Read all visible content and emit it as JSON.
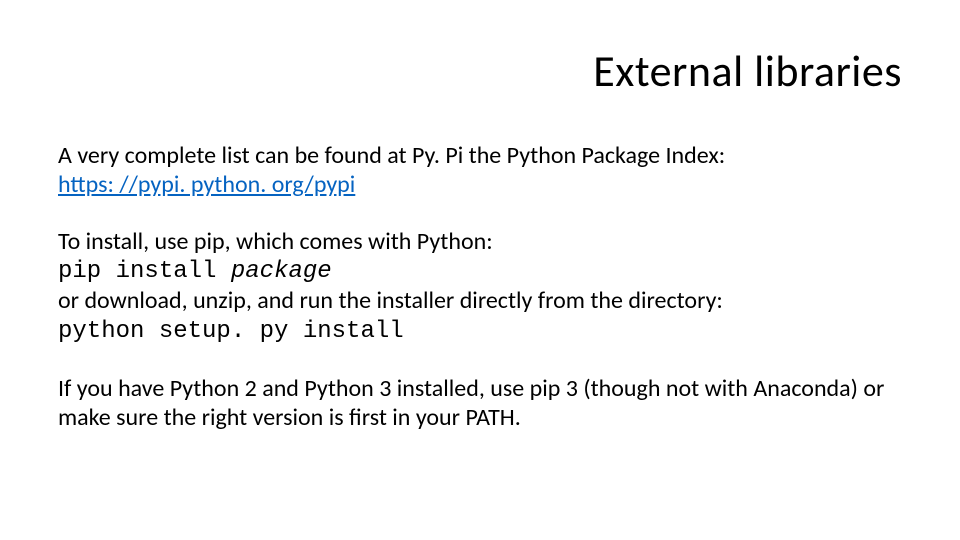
{
  "title": "External libraries",
  "para1": {
    "intro": "A very complete list can be found at Py. Pi the Python Package Index:",
    "link": "https: //pypi. python. org/pypi"
  },
  "para2": {
    "line1": "To install, use pip, which comes with Python:",
    "cmd1_prefix": "pip install ",
    "cmd1_pkg": "package",
    "line2": "or download, unzip, and run the installer directly from the directory:",
    "cmd2": "python setup. py install"
  },
  "para3": "If you have Python 2 and Python 3 installed, use pip 3 (though not with Anaconda) or make sure the right version is first in your PATH."
}
